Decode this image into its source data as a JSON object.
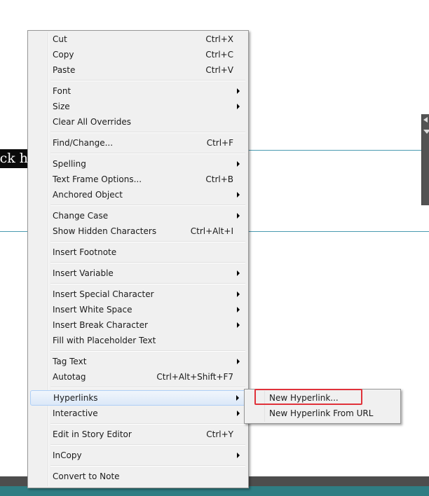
{
  "background": {
    "text_fragment": "ck h",
    "guide_color": "#4a9ab0",
    "status_bar_color": "#2f7d83"
  },
  "context_menu": {
    "groups": [
      [
        {
          "label": "Cut",
          "shortcut": "Ctrl+X",
          "submenu": false
        },
        {
          "label": "Copy",
          "shortcut": "Ctrl+C",
          "submenu": false
        },
        {
          "label": "Paste",
          "shortcut": "Ctrl+V",
          "submenu": false
        }
      ],
      [
        {
          "label": "Font",
          "shortcut": "",
          "submenu": true
        },
        {
          "label": "Size",
          "shortcut": "",
          "submenu": true
        },
        {
          "label": "Clear All Overrides",
          "shortcut": "",
          "submenu": false
        }
      ],
      [
        {
          "label": "Find/Change...",
          "shortcut": "Ctrl+F",
          "submenu": false
        }
      ],
      [
        {
          "label": "Spelling",
          "shortcut": "",
          "submenu": true
        },
        {
          "label": "Text Frame Options...",
          "shortcut": "Ctrl+B",
          "submenu": false
        },
        {
          "label": "Anchored Object",
          "shortcut": "",
          "submenu": true
        }
      ],
      [
        {
          "label": "Change Case",
          "shortcut": "",
          "submenu": true
        },
        {
          "label": "Show Hidden Characters",
          "shortcut": "Ctrl+Alt+I",
          "submenu": false
        }
      ],
      [
        {
          "label": "Insert Footnote",
          "shortcut": "",
          "submenu": false
        }
      ],
      [
        {
          "label": "Insert Variable",
          "shortcut": "",
          "submenu": true
        }
      ],
      [
        {
          "label": "Insert Special Character",
          "shortcut": "",
          "submenu": true
        },
        {
          "label": "Insert White Space",
          "shortcut": "",
          "submenu": true
        },
        {
          "label": "Insert Break Character",
          "shortcut": "",
          "submenu": true
        },
        {
          "label": "Fill with Placeholder Text",
          "shortcut": "",
          "submenu": false
        }
      ],
      [
        {
          "label": "Tag Text",
          "shortcut": "",
          "submenu": true
        },
        {
          "label": "Autotag",
          "shortcut": "Ctrl+Alt+Shift+F7",
          "submenu": false
        }
      ],
      [
        {
          "label": "Hyperlinks",
          "shortcut": "",
          "submenu": true,
          "highlighted": true
        },
        {
          "label": "Interactive",
          "shortcut": "",
          "submenu": true
        }
      ],
      [
        {
          "label": "Edit in Story Editor",
          "shortcut": "Ctrl+Y",
          "submenu": false
        }
      ],
      [
        {
          "label": "InCopy",
          "shortcut": "",
          "submenu": true
        }
      ],
      [
        {
          "label": "Convert to Note",
          "shortcut": "",
          "submenu": false
        }
      ]
    ]
  },
  "hyperlinks_submenu": {
    "items": [
      {
        "label": "New Hyperlink...",
        "annotated": true
      },
      {
        "label": "New Hyperlink From URL",
        "annotated": false
      }
    ],
    "annotation_color": "#e0323a"
  }
}
